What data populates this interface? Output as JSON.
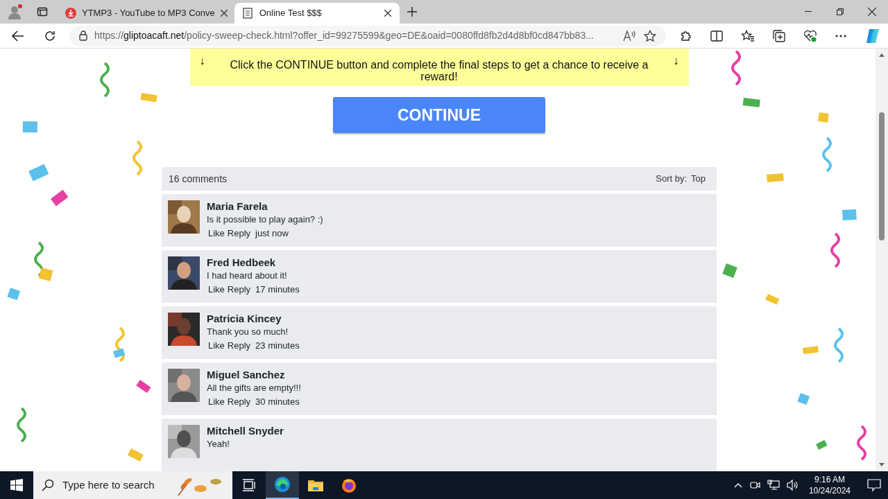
{
  "browser": {
    "tabs": [
      {
        "title": "YTMP3 - YouTube to MP3 Conve",
        "selected": false
      },
      {
        "title": "Online Test $$$",
        "selected": true
      }
    ],
    "url": {
      "scheme": "https://",
      "host": "gliptoacaft.net",
      "path": "/policy-sweep-check.html?offer_id=99275599&geo=DE&oaid=0080ffd8fb2d4d8bf0cd847bb83..."
    }
  },
  "banner": {
    "arrow_left": "↓",
    "text": "Click the CONTINUE button and complete the final steps to get a chance to receive a reward!",
    "arrow_right": "↓"
  },
  "continue_button": "CONTINUE",
  "comments": {
    "count": "16 comments",
    "sort_label": "Sort by:",
    "sort_value": "Top",
    "items": [
      {
        "name": "Maria Farela",
        "text": "Is it possible to play again? :)",
        "like": "Like",
        "reply": "Reply",
        "time": "just now"
      },
      {
        "name": "Fred Hedbeek",
        "text": "I had heard about it!",
        "like": "Like",
        "reply": "Reply",
        "time": "17 minutes"
      },
      {
        "name": "Patricia Kincey",
        "text": "Thank you so much!",
        "like": "Like",
        "reply": "Reply",
        "time": "23 minutes"
      },
      {
        "name": "Miguel Sanchez",
        "text": "All the gifts are empty!!!",
        "like": "Like",
        "reply": "Reply",
        "time": "30 minutes"
      },
      {
        "name": "Mitchell Snyder",
        "text": "Yeah!"
      }
    ]
  },
  "taskbar": {
    "search_placeholder": "Type here to search",
    "time": "9:16 AM",
    "date": "10/24/2024"
  }
}
